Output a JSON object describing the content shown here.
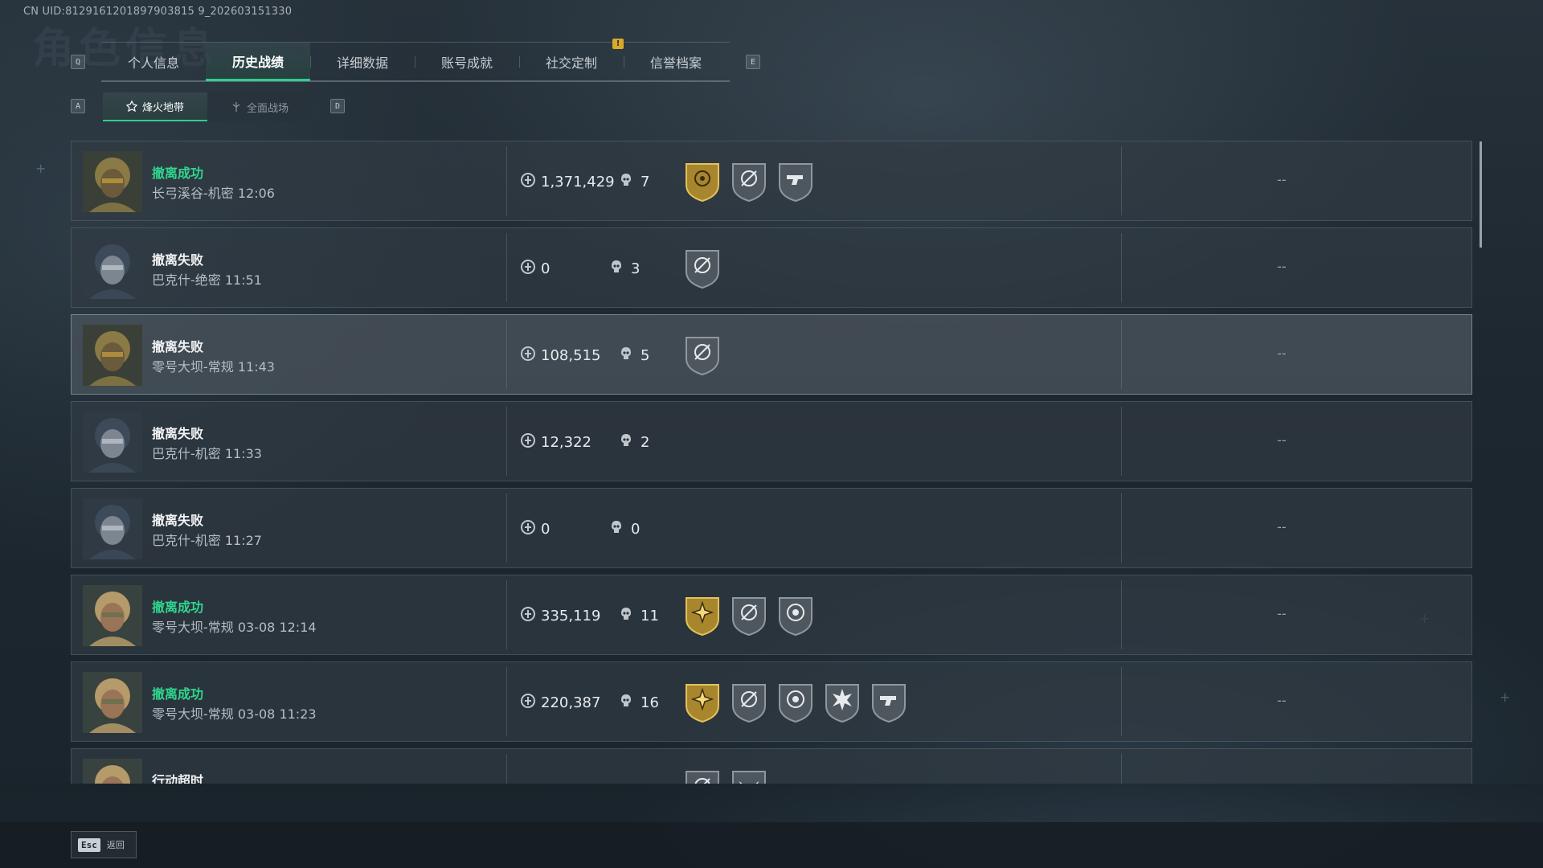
{
  "uid": "CN UID:8129161201897903815 9_202603151330",
  "background_title": "角色信息",
  "tabs": {
    "left_key": "Q",
    "right_key": "E",
    "notice": "!",
    "items": [
      {
        "label": "个人信息"
      },
      {
        "label": "历史战绩"
      },
      {
        "label": "详细数据"
      },
      {
        "label": "账号成就"
      },
      {
        "label": "社交定制"
      },
      {
        "label": "信誉档案"
      }
    ]
  },
  "subtabs": {
    "left_key": "A",
    "right_key": "D",
    "items": [
      {
        "label": "烽火地带"
      },
      {
        "label": "全面战场"
      }
    ]
  },
  "records": [
    {
      "status": "撤离成功",
      "result": "success",
      "map": "长弓溪谷-机密 12:06",
      "money": "1,371,429",
      "kills": "7",
      "badges": [
        "gold-medal",
        "crosshair",
        "hand-gun"
      ],
      "extra": "--",
      "avatar": "gold-helmet"
    },
    {
      "status": "撤离失败",
      "result": "fail",
      "map": "巴克什-绝密 11:51",
      "money": "0",
      "kills": "3",
      "badges": [
        "crosshair"
      ],
      "extra": "--",
      "avatar": "blue-helmet"
    },
    {
      "status": "撤离失败",
      "result": "fail",
      "map": "零号大坝-常规 11:43",
      "money": "108,515",
      "kills": "5",
      "badges": [
        "crosshair"
      ],
      "extra": "--",
      "avatar": "gold-helmet"
    },
    {
      "status": "撤离失败",
      "result": "fail",
      "map": "巴克什-机密 11:33",
      "money": "12,322",
      "kills": "2",
      "badges": [],
      "extra": "--",
      "avatar": "blue-helmet"
    },
    {
      "status": "撤离失败",
      "result": "fail",
      "map": "巴克什-机密 11:27",
      "money": "0",
      "kills": "0",
      "badges": [],
      "extra": "--",
      "avatar": "blue-helmet"
    },
    {
      "status": "撤离成功",
      "result": "success",
      "map": "零号大坝-常规 03-08 12:14",
      "money": "335,119",
      "kills": "11",
      "badges": [
        "gold-star",
        "crosshair",
        "skull-target"
      ],
      "extra": "--",
      "avatar": "blond-operator"
    },
    {
      "status": "撤离成功",
      "result": "success",
      "map": "零号大坝-常规 03-08 11:23",
      "money": "220,387",
      "kills": "16",
      "badges": [
        "gold-star",
        "crosshair",
        "skull-target",
        "burst",
        "hand-gun"
      ],
      "extra": "--",
      "avatar": "blond-operator"
    },
    {
      "status": "行动超时",
      "result": "fail",
      "map": "",
      "money": "",
      "kills": "",
      "badges": [
        "crosshair",
        "wings"
      ],
      "extra": "",
      "avatar": "blond-operator"
    }
  ],
  "footer": {
    "key": "Esc",
    "label": "返回"
  },
  "colors": {
    "accent": "#2fcf8a",
    "success": "#2fd68e",
    "gold_badge": "#c9a23a",
    "gray_badge": "#5d666d"
  }
}
